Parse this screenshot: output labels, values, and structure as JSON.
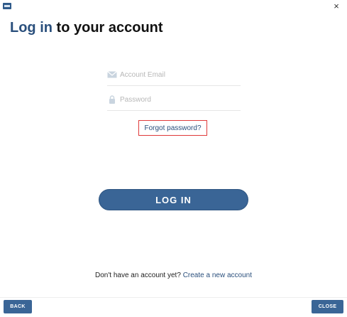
{
  "window": {
    "close_symbol": "×"
  },
  "title": {
    "accent": "Log in",
    "rest": " to your account"
  },
  "email": {
    "placeholder": "Account Email",
    "icon": "envelope-icon"
  },
  "password": {
    "placeholder": "Password",
    "icon": "lock-icon"
  },
  "forgot_link": "Forgot password?",
  "login_button": "LOG IN",
  "signup": {
    "prompt": "Don't have an account yet? ",
    "link": "Create a new account"
  },
  "footer": {
    "back": "BACK",
    "close": "CLOSE"
  },
  "colors": {
    "accent": "#2a4f7c",
    "button": "#3a6596",
    "highlight_border": "#e03a3a"
  }
}
